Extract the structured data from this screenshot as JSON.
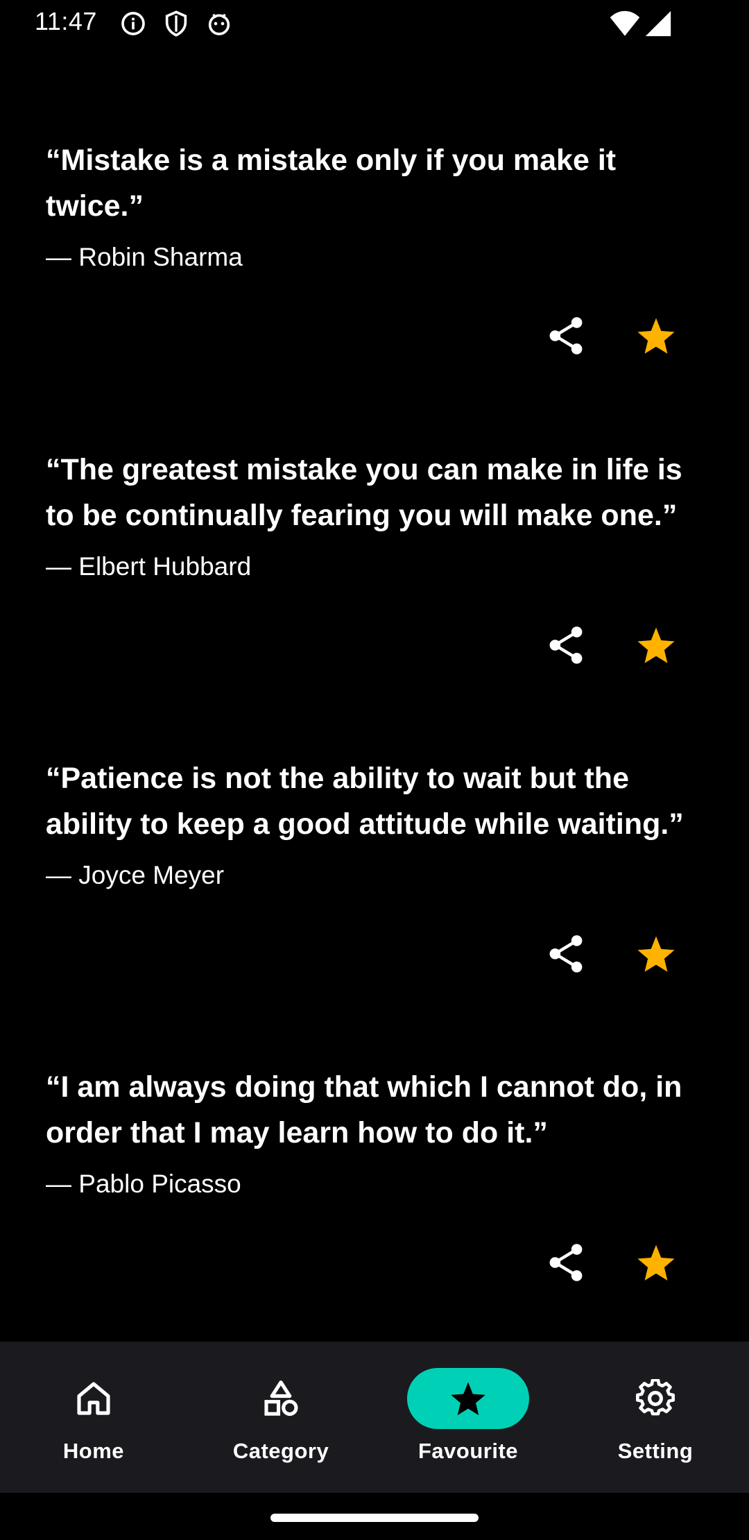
{
  "status_bar": {
    "time": "11:47",
    "left_icons": [
      "info-icon",
      "shield-icon",
      "android-debug-icon"
    ],
    "right_icons": [
      "wifi-icon",
      "signal-icon"
    ]
  },
  "quotes": [
    {
      "text": "“Mistake is a mistake only if you make it twice.”",
      "author": "— Robin Sharma",
      "favourite": true
    },
    {
      "text": "“The greatest mistake you can make in life is to be continually fearing you will make one.”",
      "author": "— Elbert Hubbard",
      "favourite": true
    },
    {
      "text": "“Patience is not the ability to wait but the ability to keep a good attitude while waiting.”",
      "author": "— Joyce Meyer",
      "favourite": true
    },
    {
      "text": "“I am always doing that which I cannot do, in order that I may learn how to do it.”",
      "author": "— Pablo Picasso",
      "favourite": true
    }
  ],
  "bottom_nav": {
    "items": [
      {
        "label": "Home",
        "icon": "home-icon",
        "active": false
      },
      {
        "label": "Category",
        "icon": "shapes-icon",
        "active": false
      },
      {
        "label": "Favourite",
        "icon": "star-icon",
        "active": true
      },
      {
        "label": "Setting",
        "icon": "gear-icon",
        "active": false
      }
    ]
  },
  "colors": {
    "background": "#000000",
    "text": "#ffffff",
    "star": "#ffb300",
    "active_nav": "#00d1b6",
    "nav_background": "#1b1b1f"
  }
}
